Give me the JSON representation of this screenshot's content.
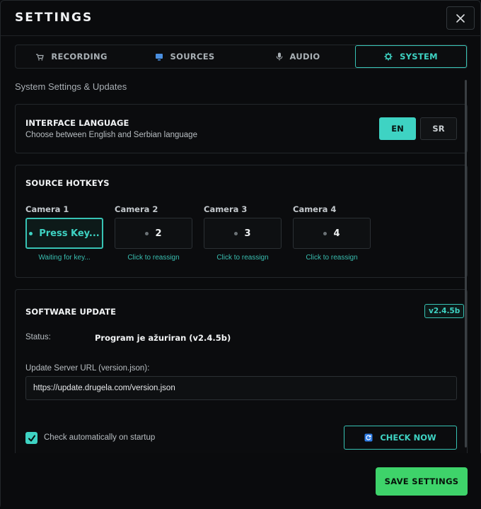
{
  "window": {
    "title": "SETTINGS"
  },
  "tabs": [
    {
      "label": "RECORDING",
      "icon": "cart-icon",
      "active": false
    },
    {
      "label": "SOURCES",
      "icon": "monitor-icon",
      "active": false
    },
    {
      "label": "AUDIO",
      "icon": "microphone-icon",
      "active": false
    },
    {
      "label": "SYSTEM",
      "icon": "gear-icon",
      "active": true
    }
  ],
  "section_title": "System Settings & Updates",
  "language": {
    "title": "INTERFACE LANGUAGE",
    "subtitle": "Choose between English and Serbian language",
    "options": [
      "EN",
      "SR"
    ],
    "selected": "EN"
  },
  "hotkeys": {
    "title": "SOURCE HOTKEYS",
    "cameras": [
      {
        "label": "Camera 1",
        "value": "Press Key...",
        "hint": "Waiting for key...",
        "active": true
      },
      {
        "label": "Camera 2",
        "value": "2",
        "hint": "Click to reassign",
        "active": false
      },
      {
        "label": "Camera 3",
        "value": "3",
        "hint": "Click to reassign",
        "active": false
      },
      {
        "label": "Camera 4",
        "value": "4",
        "hint": "Click to reassign",
        "active": false
      }
    ]
  },
  "update": {
    "title": "SOFTWARE UPDATE",
    "version_badge": "v2.4.5b",
    "status_label": "Status:",
    "status_value": "Program je ažuriran (v2.4.5b)",
    "url_label": "Update Server URL (version.json):",
    "url_value": "https://update.drugela.com/version.json",
    "auto_check_label": "Check automatically on startup",
    "auto_check_checked": true,
    "check_now_label": "CHECK NOW"
  },
  "footer": {
    "save_label": "SAVE SETTINGS"
  },
  "colors": {
    "accent": "#3ed3c3",
    "save": "#3ed36a",
    "background": "#0a0b0d"
  }
}
